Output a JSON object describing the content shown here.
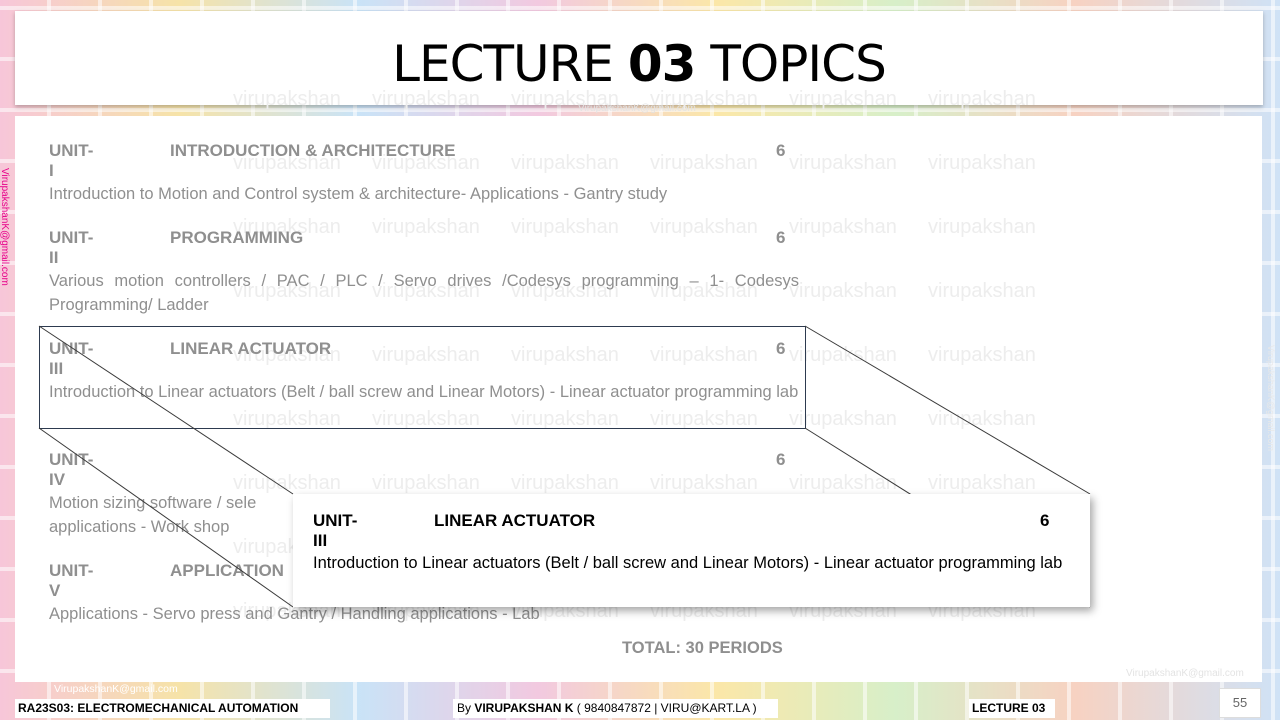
{
  "slide": {
    "title_prefix": "LECTURE ",
    "title_number": "03",
    "title_suffix": " TOPICS",
    "watermark_text": "virupakshan",
    "email_watermark": "VirupakshanK@gmail.com",
    "units": [
      {
        "code": "UNIT-I",
        "name": "INTRODUCTION & ARCHITECTURE",
        "hours": "6",
        "description": "Introduction to Motion and Control system & architecture- Applications - Gantry study"
      },
      {
        "code": "UNIT-II",
        "name": "PROGRAMMING",
        "hours": "6",
        "description": "Various motion controllers / PAC / PLC / Servo drives /Codesys programming – 1- Codesys Programming/ Ladder"
      },
      {
        "code": "UNIT-III",
        "name": "LINEAR ACTUATOR",
        "hours": "6",
        "description": "Introduction to Linear actuators (Belt / ball screw and Linear Motors) - Linear actuator programming lab"
      },
      {
        "code": "UNIT-IV",
        "name": "",
        "hours": "6",
        "description": "Motion sizing software / sele"
      },
      {
        "code": "UNIT-V",
        "name": "APPLICATION",
        "hours": "",
        "description": "Applications - Servo press and Gantry / Handling applications - Lab"
      }
    ],
    "unit4_desc_line2": "applications - Work shop",
    "total": "TOTAL: 30 PERIODS",
    "zoom_popup": {
      "code": "UNIT-III",
      "name": "LINEAR ACTUATOR",
      "hours": "6",
      "description": "Introduction to Linear actuators (Belt / ball screw and Linear Motors) - Linear actuator programming lab"
    },
    "slide_number": "55"
  },
  "footer": {
    "course": "RA23S03:   ELECTROMECHANICAL AUTOMATION",
    "by_prefix": "By ",
    "author": "VIRUPAKSHAN K",
    "contact": " ( 9840847872 | VIRU@KART.LA )",
    "lecture": "LECTURE 03"
  }
}
